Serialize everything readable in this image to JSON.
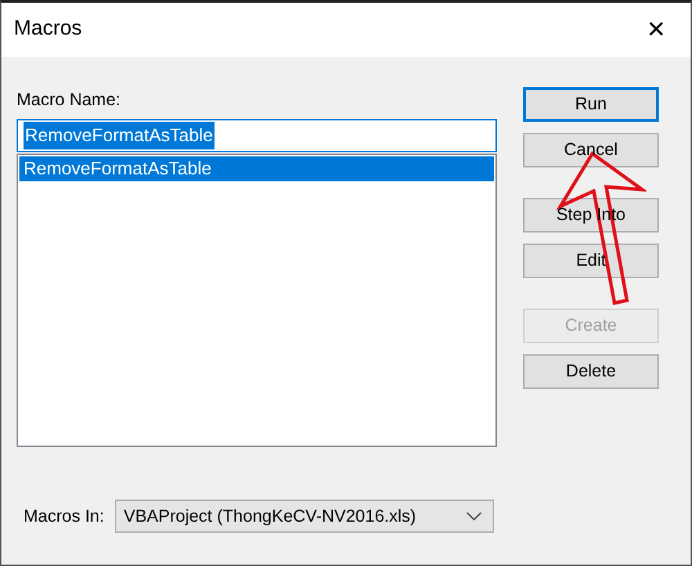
{
  "window": {
    "title": "Macros",
    "close": "✕"
  },
  "macro_name": {
    "label": "Macro Name:",
    "value": "RemoveFormatAsTable"
  },
  "macros": [
    {
      "name": "RemoveFormatAsTable",
      "selected": true
    }
  ],
  "button_groups": [
    [
      {
        "label": "Run",
        "default": true,
        "disabled": false
      },
      {
        "label": "Cancel",
        "default": false,
        "disabled": false
      }
    ],
    [
      {
        "label": "Step Into",
        "default": false,
        "disabled": false
      },
      {
        "label": "Edit",
        "default": false,
        "disabled": false
      }
    ],
    [
      {
        "label": "Create",
        "default": false,
        "disabled": true
      },
      {
        "label": "Delete",
        "default": false,
        "disabled": false
      }
    ]
  ],
  "macros_in": {
    "label": "Macros In:",
    "value": "VBAProject (ThongKeCV-NV2016.xls)"
  },
  "annotation": {
    "kind": "arrow"
  }
}
